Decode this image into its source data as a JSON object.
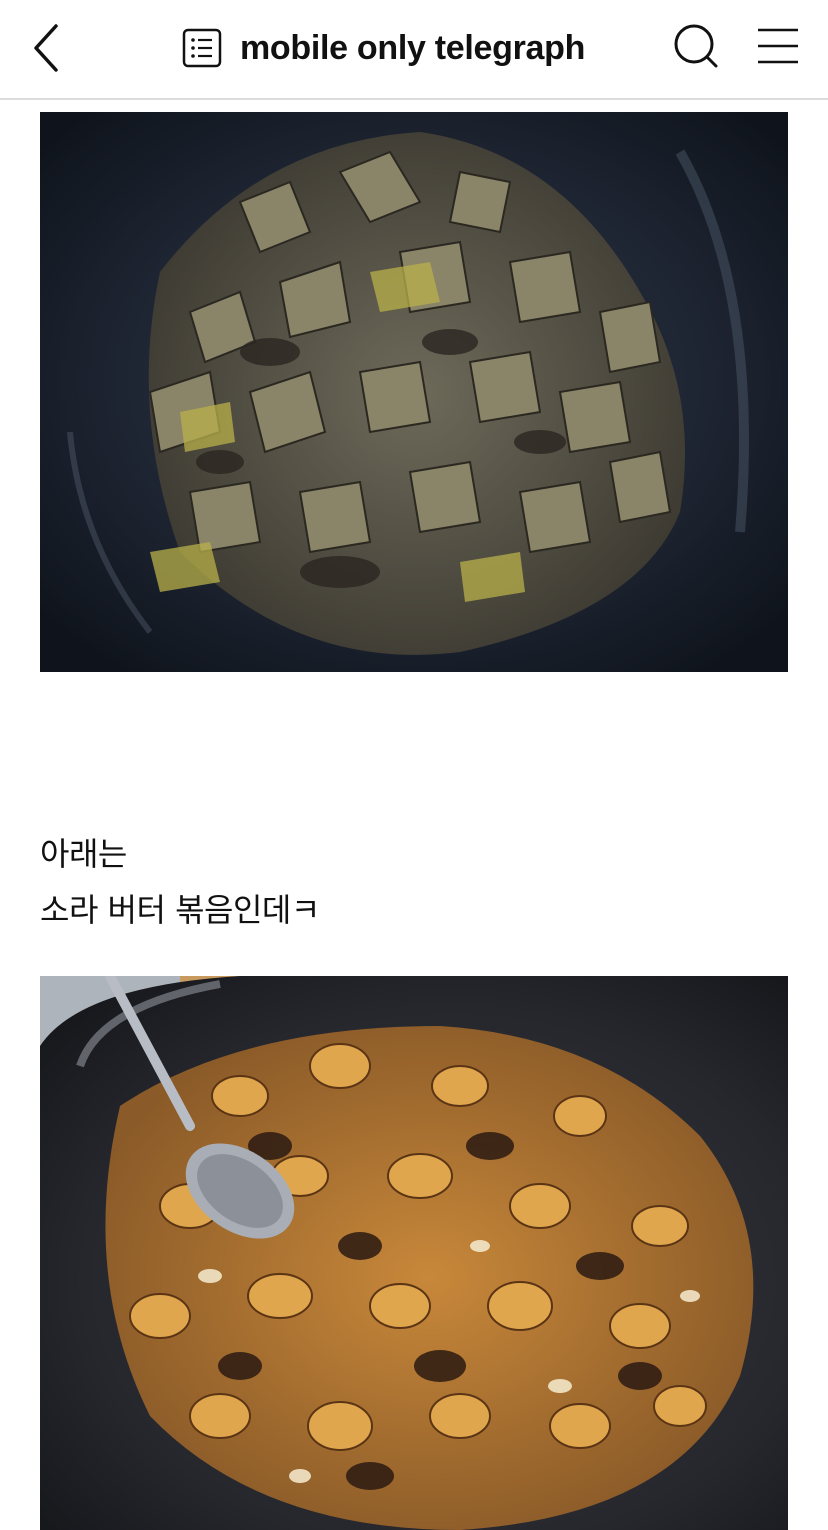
{
  "header": {
    "title": "mobile only telegraph",
    "back_icon": "chevron-left-icon",
    "doc_icon": "list-document-icon",
    "search_icon": "search-icon",
    "menu_icon": "hamburger-menu-icon"
  },
  "content": {
    "lines": [
      "아래는",
      "소라 버터 볶음인데ㅋ"
    ]
  }
}
